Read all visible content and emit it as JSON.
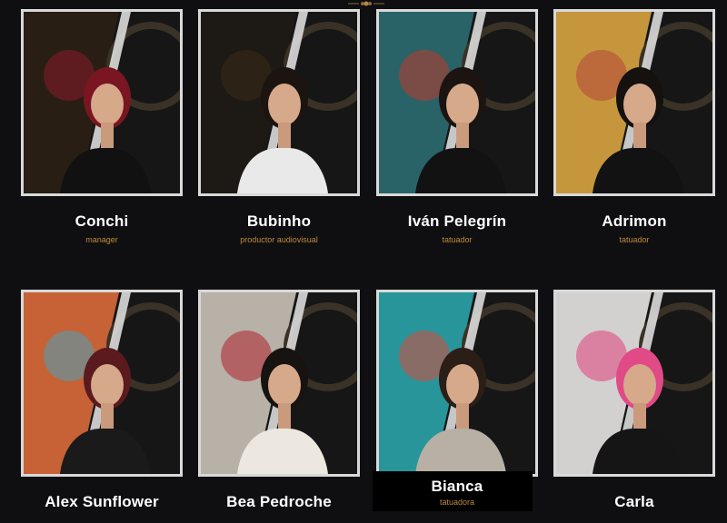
{
  "team": [
    {
      "name": "Conchi",
      "role": "manager",
      "bg": "#2a1f14",
      "accent": "#8b1c2a",
      "hair": "#7a1621",
      "shirt": "#111111"
    },
    {
      "name": "Bubinho",
      "role": "productor audiovisual",
      "bg": "#1e1a14",
      "accent": "#3b2a17",
      "hair": "#1b1410",
      "shirt": "#e9e9e9"
    },
    {
      "name": "Iván Pelegrín",
      "role": "tatuador",
      "bg": "#2b6b70",
      "accent": "#c0392b",
      "hair": "#1b1410",
      "shirt": "#121212"
    },
    {
      "name": "Adrimon",
      "role": "tatuador",
      "bg": "#d9a440",
      "accent": "#b4463a",
      "hair": "#14110e",
      "shirt": "#121212"
    },
    {
      "name": "Alex Sunflower",
      "role": "",
      "bg": "#d96a3a",
      "accent": "#4aa0b8",
      "hair": "#5a1a1e",
      "shirt": "#1a1a1a"
    },
    {
      "name": "Bea Pedroche",
      "role": "",
      "bg": "#c9c2b8",
      "accent": "#b0202a",
      "hair": "#171310",
      "shirt": "#ece8e0"
    },
    {
      "name": "Bianca",
      "role": "tatuadora",
      "bg": "#2aa3a8",
      "accent": "#d94a3a",
      "hair": "#2a1e16",
      "shirt": "#b8b0a4"
    },
    {
      "name": "Carla",
      "role": "",
      "bg": "#e8e4e4",
      "accent": "#e0407a",
      "hair": "#e04a86",
      "shirt": "#151515"
    }
  ]
}
